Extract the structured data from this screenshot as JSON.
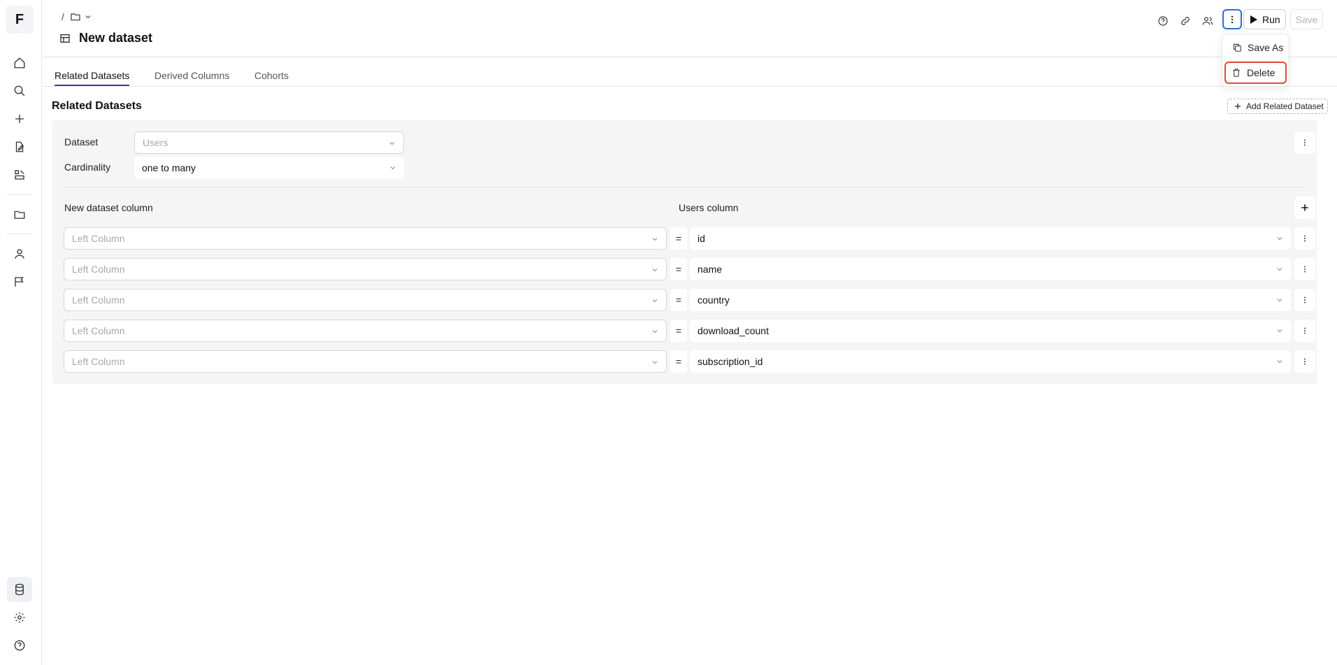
{
  "sidebar": {
    "logo": "F",
    "icons": [
      "home-icon",
      "search-icon",
      "plus-icon",
      "edit-doc-icon",
      "model-icon",
      "folder-icon",
      "user-icon",
      "flag-icon",
      "database-icon",
      "gear-icon",
      "help-icon"
    ]
  },
  "header": {
    "breadcrumb_sep": "/",
    "title": "New dataset",
    "run_label": "Run",
    "save_label": "Save"
  },
  "menu": {
    "items": [
      {
        "label": "Save As",
        "icon": "copy-icon"
      },
      {
        "label": "Delete",
        "icon": "trash-icon"
      }
    ]
  },
  "tabs": [
    {
      "label": "Related Datasets",
      "active": true
    },
    {
      "label": "Derived Columns",
      "active": false
    },
    {
      "label": "Cohorts",
      "active": false
    }
  ],
  "section": {
    "title": "Related Datasets",
    "add_label": "Add Related Dataset"
  },
  "config": {
    "dataset_label": "Dataset",
    "dataset_placeholder": "Users",
    "cardinality_label": "Cardinality",
    "cardinality_value": "one to many"
  },
  "columns": {
    "left_header": "New dataset column",
    "right_header": "Users column",
    "eq": "=",
    "left_placeholder": "Left Column",
    "rows": [
      {
        "right": "id"
      },
      {
        "right": "name"
      },
      {
        "right": "country"
      },
      {
        "right": "download_count"
      },
      {
        "right": "subscription_id"
      }
    ]
  },
  "colors": {
    "accent": "#1f4fa8",
    "focus": "#2d6ae0",
    "highlight": "#e0483a",
    "panel": "#f5f5f5"
  }
}
